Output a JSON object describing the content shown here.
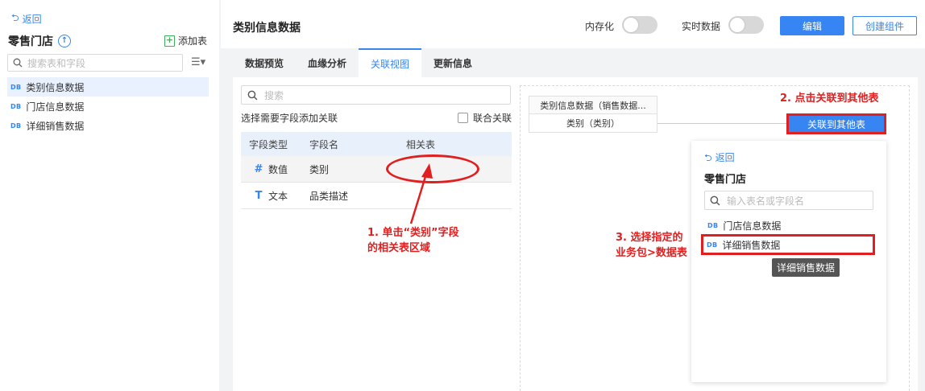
{
  "sidebar": {
    "back_label": "返回",
    "package_name": "零售门店",
    "add_table_label": "添加表",
    "search_placeholder": "搜索表和字段",
    "items": [
      {
        "tag": "DB",
        "label": "类别信息数据",
        "active": true
      },
      {
        "tag": "DB",
        "label": "门店信息数据",
        "active": false
      },
      {
        "tag": "DB",
        "label": "详细销售数据",
        "active": false
      }
    ]
  },
  "header": {
    "title": "类别信息数据",
    "memory_label": "内存化",
    "realtime_label": "实时数据",
    "edit_label": "编辑",
    "create_component_label": "创建组件"
  },
  "tabs": [
    {
      "label": "数据预览",
      "active": false
    },
    {
      "label": "血缘分析",
      "active": false
    },
    {
      "label": "关联视图",
      "active": true
    },
    {
      "label": "更新信息",
      "active": false
    }
  ],
  "field_panel": {
    "search_placeholder": "搜索",
    "hint": "选择需要字段添加关联",
    "union_label": "联合关联",
    "columns": [
      "字段类型",
      "字段名",
      "相关表"
    ],
    "rows": [
      {
        "type_icon": "#",
        "type": "数值",
        "name": "类别",
        "related": ""
      },
      {
        "type_icon": "T",
        "type": "文本",
        "name": "品类描述",
        "related": ""
      }
    ]
  },
  "diagram": {
    "node_title": "类别信息数据（销售数据...",
    "node_field": "类别（类别）",
    "link_button_label": "关联到其他表"
  },
  "popover": {
    "back_label": "返回",
    "title": "零售门店",
    "search_placeholder": "输入表名或字段名",
    "items": [
      {
        "tag": "DB",
        "label": "门店信息数据"
      },
      {
        "tag": "DB",
        "label": "详细销售数据"
      }
    ],
    "tooltip": "详细销售数据"
  },
  "annotations": {
    "step1_line1": "1. 单击“类别”字段",
    "step1_line2": "的相关表区域",
    "step2": "2. 点击关联到其他表",
    "step3_line1": "3. 选择指定的",
    "step3_line2": "业务包>数据表"
  },
  "colors": {
    "accent": "#3685f2",
    "annotation": "#e02020"
  }
}
